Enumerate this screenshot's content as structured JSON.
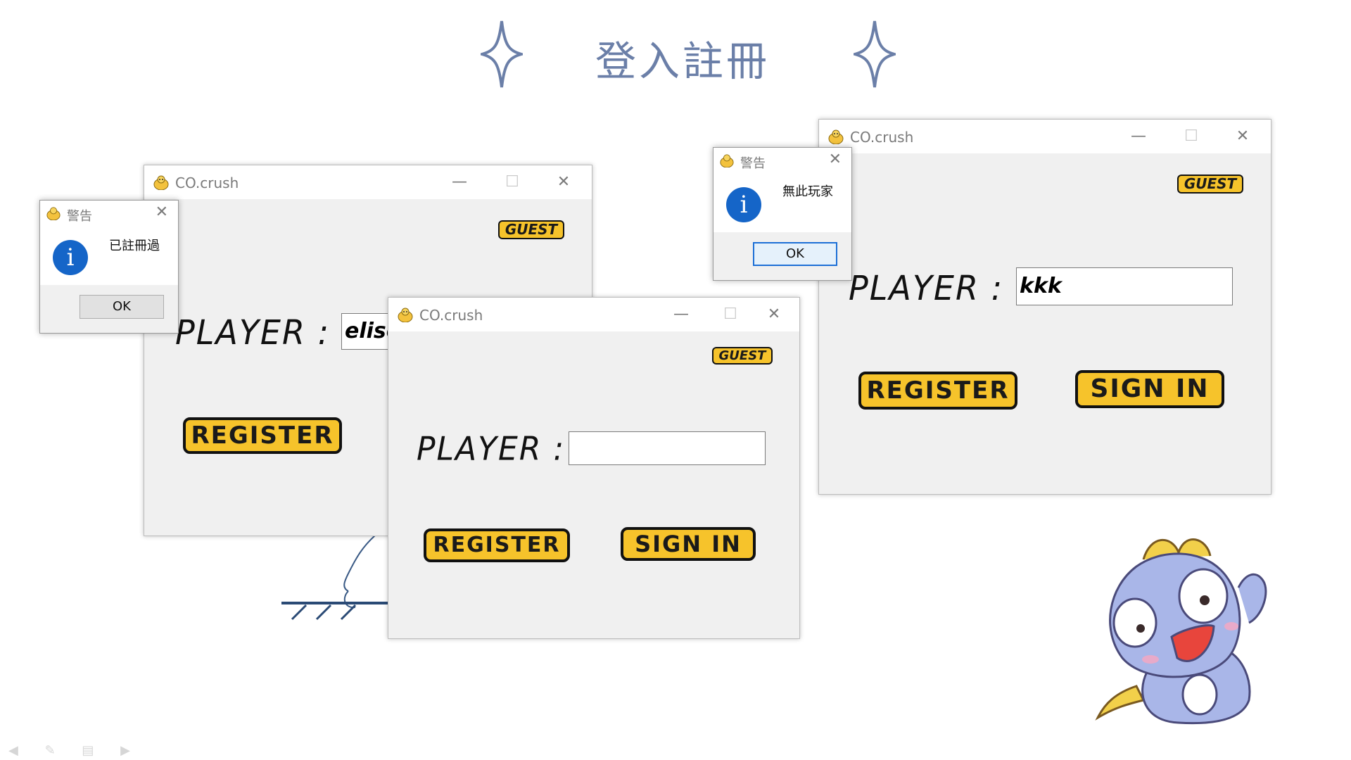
{
  "slide": {
    "title": "登入註冊"
  },
  "windows": {
    "left": {
      "title": "CO.crush",
      "guest_label": "GUEST",
      "player_label": "PLAYER :",
      "player_value": "elise",
      "register_label": "REGISTER"
    },
    "center": {
      "title": "CO.crush",
      "guest_label": "GUEST",
      "player_label": "PLAYER :",
      "player_value": "",
      "register_label": "REGISTER",
      "signin_label": "SIGN IN"
    },
    "right": {
      "title": "CO.crush",
      "guest_label": "GUEST",
      "player_label": "PLAYER :",
      "player_value": "kkk",
      "register_label": "REGISTER",
      "signin_label": "SIGN IN"
    }
  },
  "dialogs": {
    "already_registered": {
      "title": "警告",
      "message": "已註冊過",
      "ok_label": "OK"
    },
    "no_such_player": {
      "title": "警告",
      "message": "無此玩家",
      "ok_label": "OK"
    }
  },
  "icons": {
    "app": "chick-icon",
    "info": "info-icon",
    "sparkle": "sparkle-icon"
  },
  "colors": {
    "accent_yellow": "#f6c32b",
    "title_blue": "#6b7fa8",
    "info_blue": "#1565c8"
  }
}
